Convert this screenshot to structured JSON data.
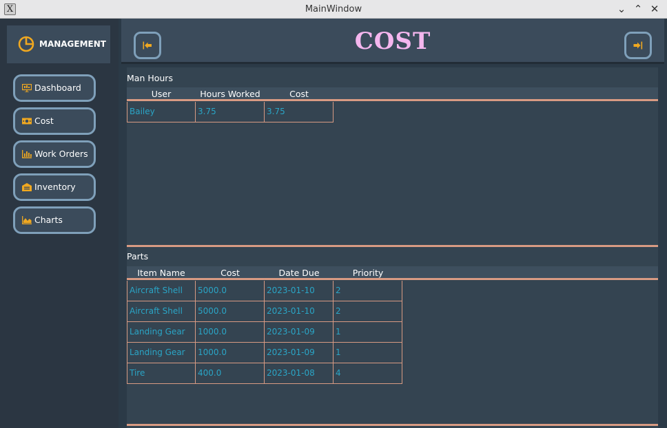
{
  "window": {
    "title": "MainWindow",
    "app_icon_glyph": "X",
    "minimize_glyph": "⌄",
    "maximize_glyph": "⌃",
    "close_glyph": "✕"
  },
  "sidebar": {
    "brand": {
      "label": "MANAGEMENT",
      "icon": "pie-chart-icon",
      "icon_color": "#f0a820"
    },
    "items": [
      {
        "label": "Dashboard",
        "icon": "dashboard-icon"
      },
      {
        "label": "Cost",
        "icon": "money-icon"
      },
      {
        "label": "Work Orders",
        "icon": "bar-chart-icon"
      },
      {
        "label": "Inventory",
        "icon": "warehouse-icon"
      },
      {
        "label": "Charts",
        "icon": "area-chart-icon"
      }
    ]
  },
  "header": {
    "title": "COST",
    "back_icon": "back-arrow-icon",
    "exit_icon": "exit-icon"
  },
  "man_hours": {
    "title": "Man Hours",
    "columns": [
      "User",
      "Hours Worked",
      "Cost"
    ],
    "rows": [
      [
        "Bailey",
        "3.75",
        "3.75"
      ]
    ]
  },
  "parts": {
    "title": "Parts",
    "columns": [
      "Item Name",
      "Cost",
      "Date Due",
      "Priority"
    ],
    "rows": [
      [
        "Aircraft Shell",
        "5000.0",
        "2023-01-10",
        "2"
      ],
      [
        "Aircraft Shell",
        "5000.0",
        "2023-01-10",
        "2"
      ],
      [
        "Landing Gear",
        "1000.0",
        "2023-01-09",
        "1"
      ],
      [
        "Landing Gear",
        "1000.0",
        "2023-01-09",
        "1"
      ],
      [
        "Tire",
        "400.0",
        "2023-01-08",
        "4"
      ]
    ]
  },
  "colors": {
    "accent_orange": "#f0a820",
    "title_pink": "#f4b6ee",
    "cell_text": "#2aa5c6",
    "table_border": "#d99b83",
    "button_border": "#7fa0ba"
  }
}
